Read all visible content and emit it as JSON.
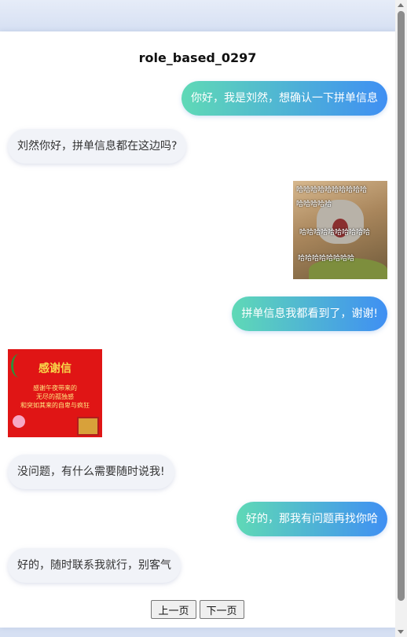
{
  "title": "role_based_0297",
  "messages": [
    {
      "role": "user",
      "text": "你好，我是刘然，想确认一下拼单信息"
    },
    {
      "role": "bot",
      "text": "刘然你好，拼单信息都在这边吗?"
    },
    {
      "role": "user",
      "sticker": "laughing-cat",
      "text_lines": [
        "哈哈哈哈哈哈哈哈哈哈",
        "哈哈哈哈哈",
        "哈哈哈哈哈哈哈哈哈哈",
        "哈哈哈哈哈哈哈哈"
      ]
    },
    {
      "role": "user",
      "text": "拼单信息我都看到了，谢谢!"
    },
    {
      "role": "bot",
      "sticker": "thank-you-card",
      "heading": "感谢信",
      "body_lines": [
        "感谢午夜带来的",
        "无尽的孤独感",
        "和突如其来的自卑与疯狂"
      ]
    },
    {
      "role": "bot",
      "text": "没问题，有什么需要随时说我!"
    },
    {
      "role": "user",
      "text": "好的，那我有问题再找你哈"
    },
    {
      "role": "bot",
      "text": "好的，随时联系我就行，别客气"
    }
  ],
  "pager": {
    "prev": "上一页",
    "next": "下一页"
  },
  "colors": {
    "user_gradient_start": "#5fd9b6",
    "user_gradient_end": "#3f8ff3",
    "bot_bubble": "#f1f3f8",
    "background": "#dfe7f6"
  }
}
